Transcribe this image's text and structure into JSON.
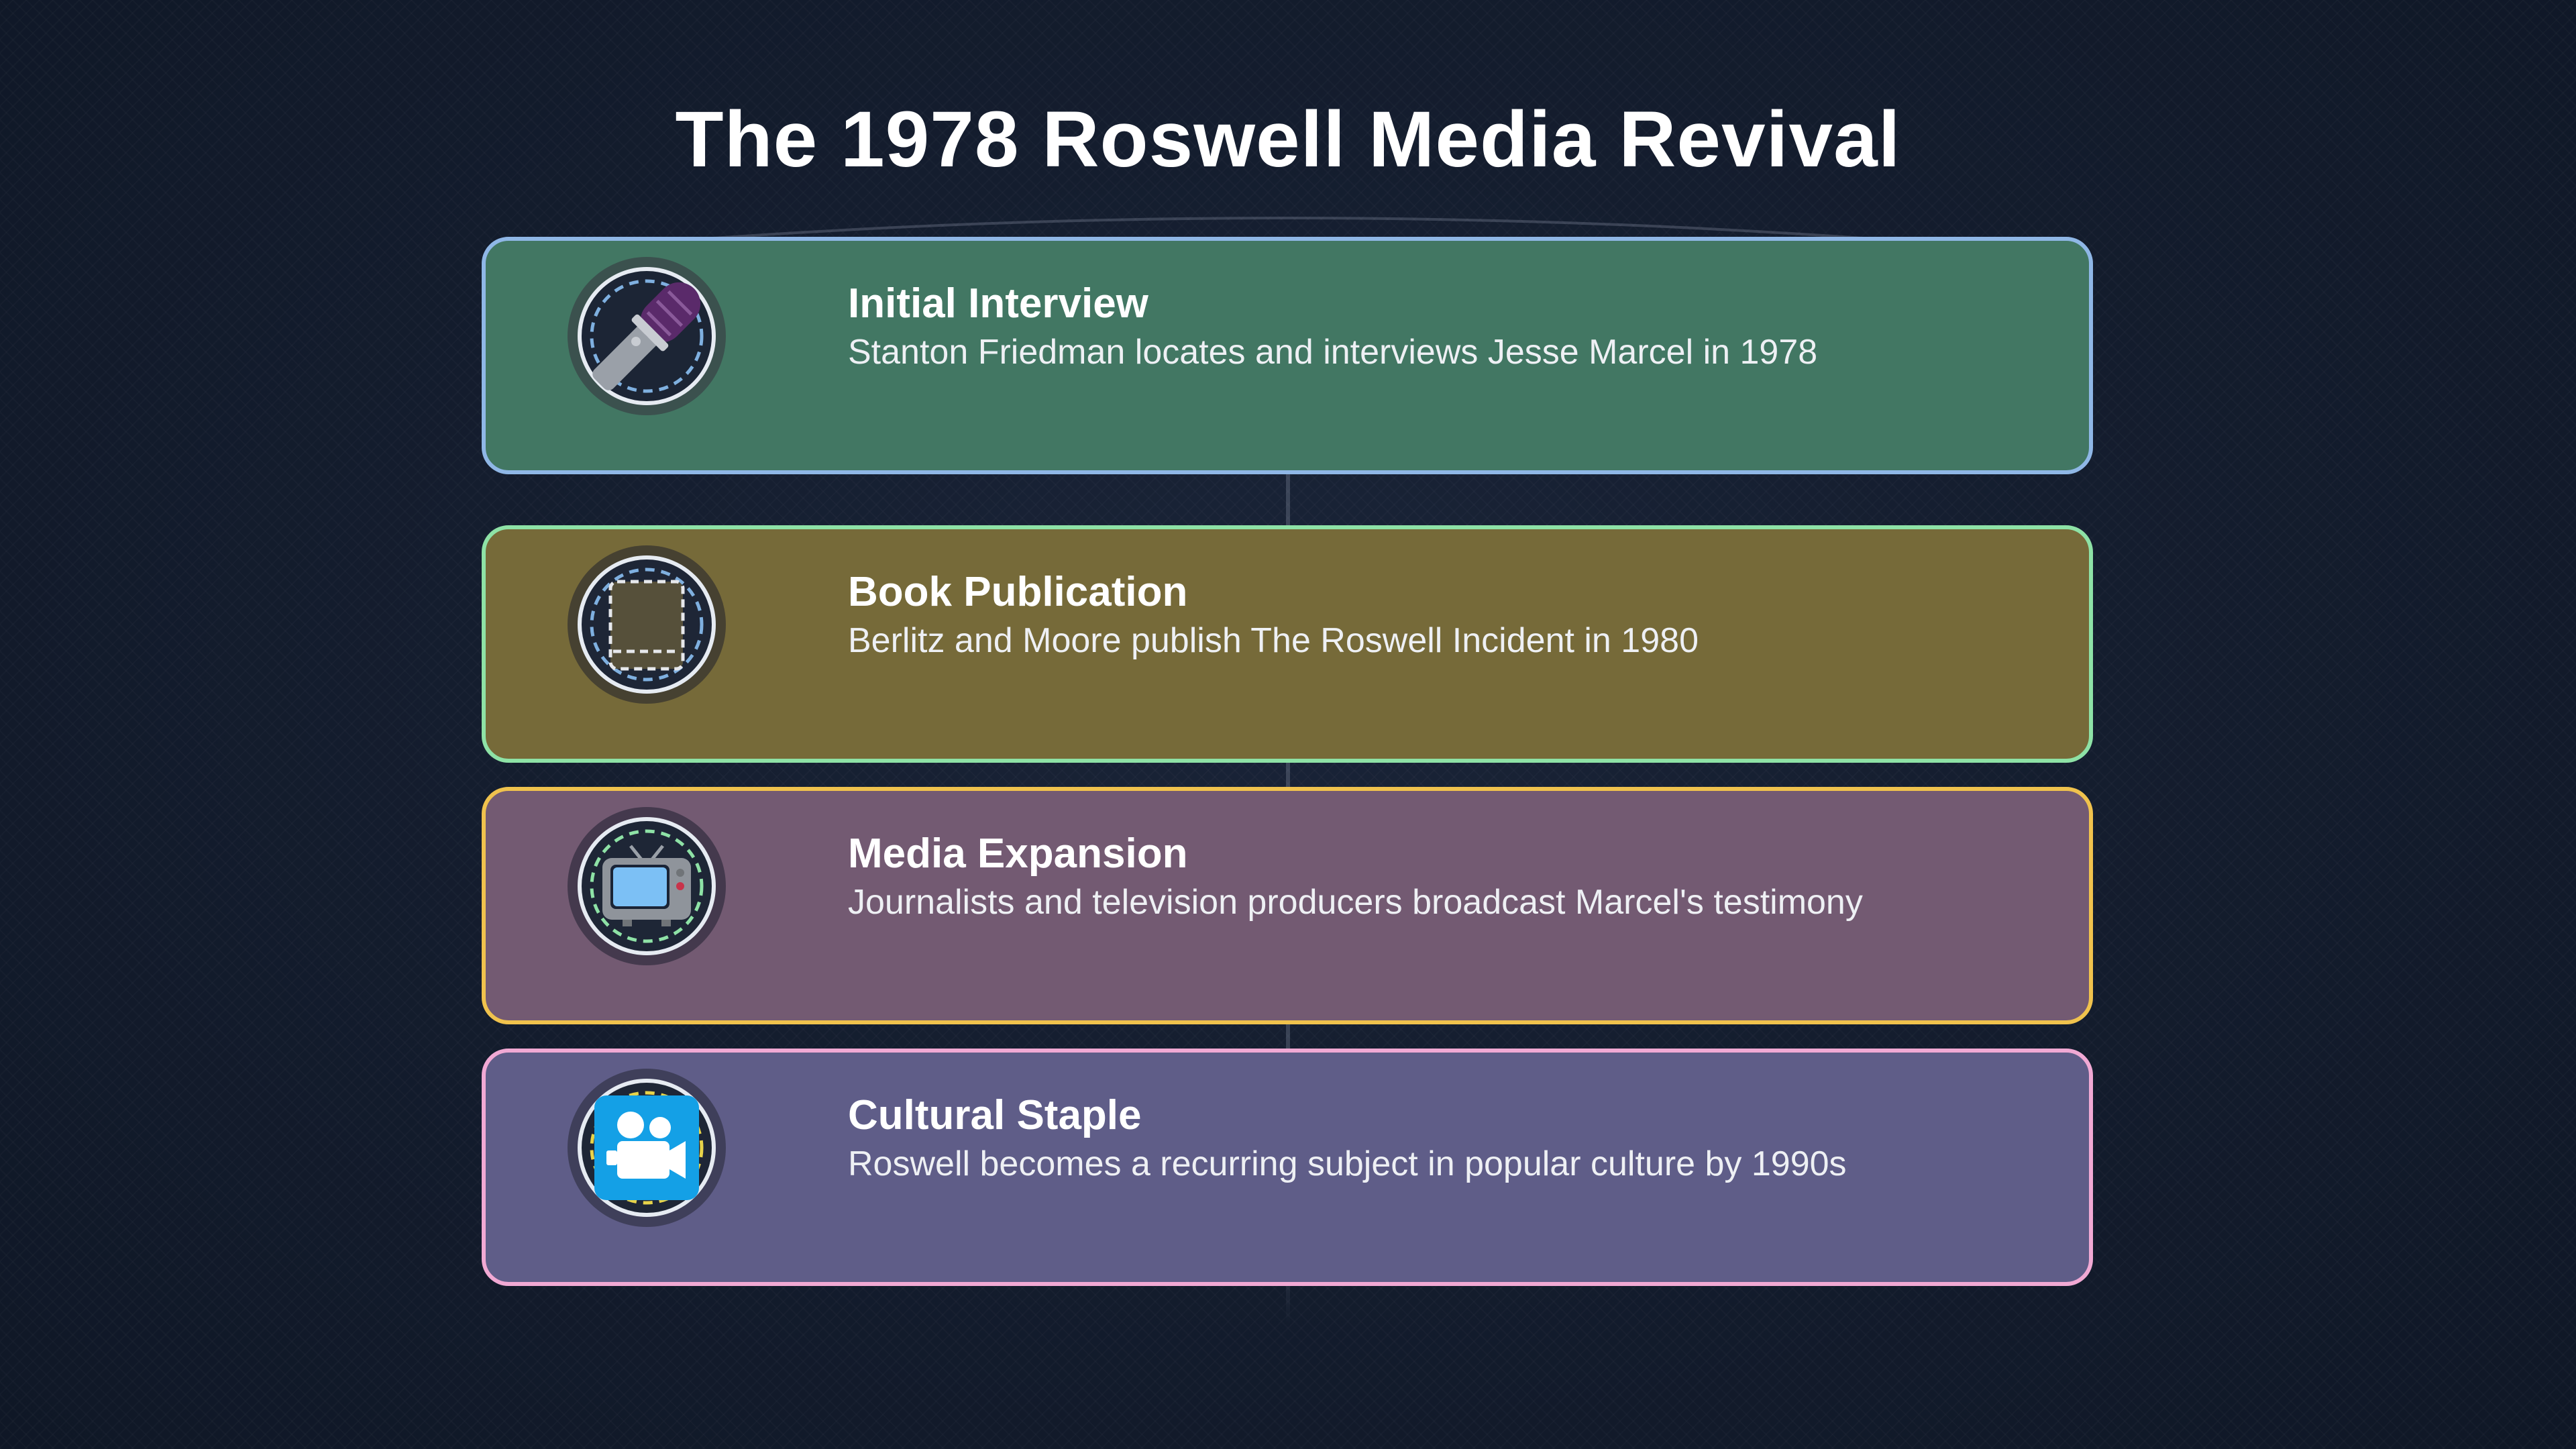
{
  "page": {
    "title": "The 1978 Roswell Media Revival"
  },
  "colors": {
    "background": "#141d2e",
    "step_fills": [
      "#427763",
      "#766a39",
      "#735a72",
      "#5f5d88"
    ],
    "step_borders": [
      "#8fb7e6",
      "#8ee2a6",
      "#f0c24d",
      "#f1a9d4"
    ]
  },
  "steps": [
    {
      "title": "Initial Interview",
      "description": "Stanton Friedman locates and interviews Jesse Marcel in 1978",
      "icon": "microphone-icon"
    },
    {
      "title": "Book Publication",
      "description": "Berlitz and Moore publish The Roswell Incident in 1980",
      "icon": "book-icon"
    },
    {
      "title": "Media Expansion",
      "description": "Journalists and television producers broadcast Marcel's testimony",
      "icon": "television-icon"
    },
    {
      "title": "Cultural Staple",
      "description": "Roswell becomes a recurring subject in popular culture by 1990s",
      "icon": "video-camera-icon"
    }
  ]
}
